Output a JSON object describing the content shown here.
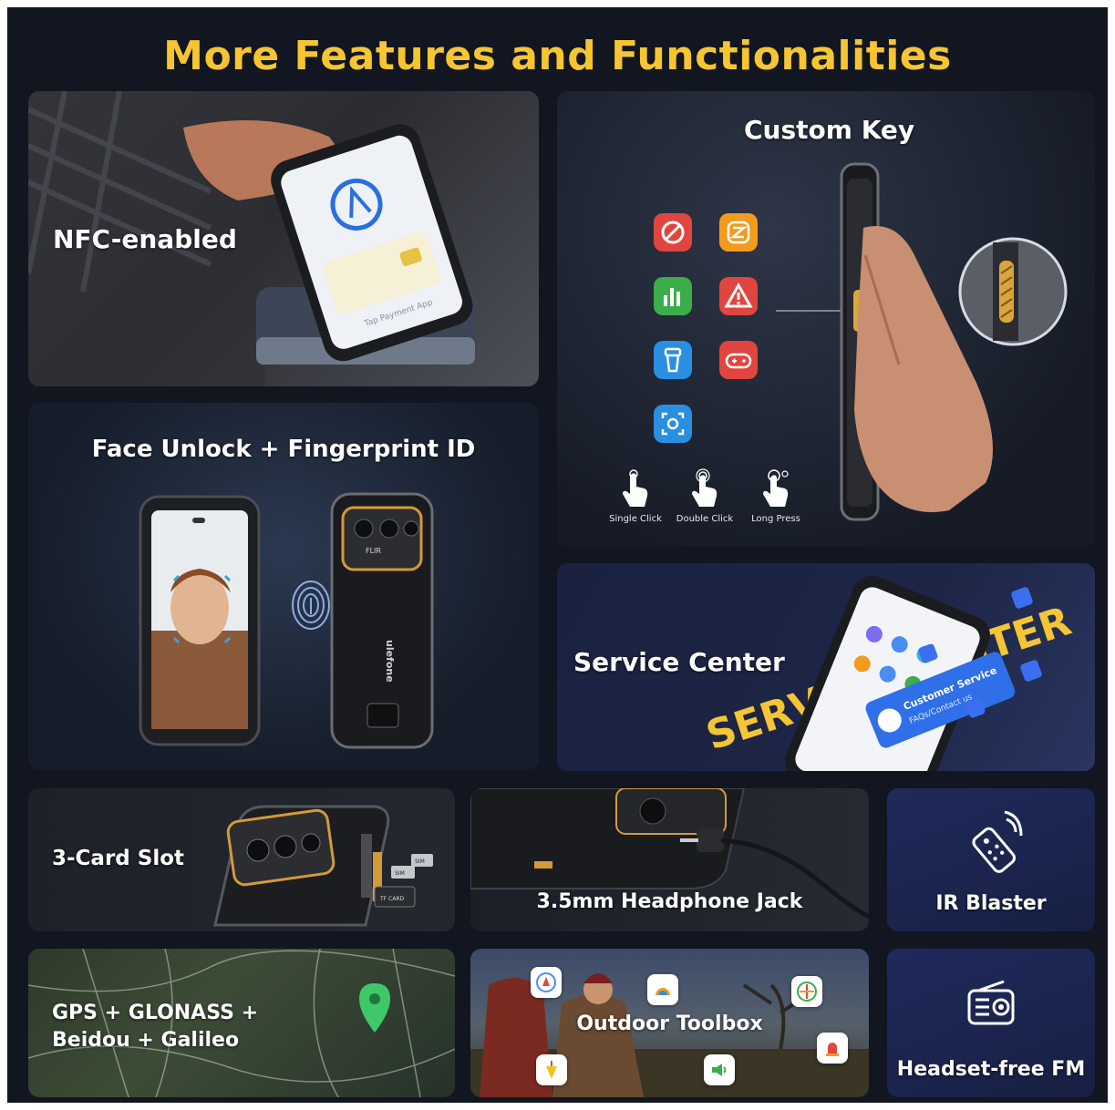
{
  "title": "More Features and Functionalities",
  "nfc": {
    "label": "NFC-enabled",
    "screen_text": "Tap Payment App"
  },
  "face": {
    "label": "Face Unlock + Fingerprint ID",
    "brand": "ulefone",
    "camera_brand": "FLIR"
  },
  "custom_key": {
    "label": "Custom Key",
    "apps": [
      {
        "icon": "do-not-disturb-icon",
        "color": "#e0463f"
      },
      {
        "icon": "z-app-icon",
        "color": "#f29b1d"
      },
      {
        "icon": "sound-meter-icon",
        "color": "#3bae4a"
      },
      {
        "icon": "sos-alert-icon",
        "color": "#e0463f"
      },
      {
        "icon": "flashlight-icon",
        "color": "#2a8fe0"
      },
      {
        "icon": "game-controller-icon",
        "color": "#e0463f"
      },
      {
        "icon": "screenshot-icon",
        "color": "#2a8fe0"
      }
    ],
    "gestures": [
      "Single Click",
      "Double Click",
      "Long Press"
    ]
  },
  "service": {
    "label": "Service Center",
    "banner": "SERVICE CENTER",
    "card_title": "Customer Service",
    "card_sub": "FAQs/Contact us"
  },
  "card_slot": {
    "label": "3-Card Slot",
    "slots": [
      "SIM",
      "SIM",
      "TF CARD"
    ]
  },
  "jack": {
    "label": "3.5mm Headphone Jack"
  },
  "ir": {
    "label": "IR Blaster"
  },
  "gps": {
    "line1": "GPS + GLONASS +",
    "line2": "Beidou + Galileo"
  },
  "toolbox": {
    "label": "Outdoor Toolbox"
  },
  "fm": {
    "label": "Headset-free FM"
  },
  "colors": {
    "accent": "#f7c531",
    "background": "#111620"
  }
}
